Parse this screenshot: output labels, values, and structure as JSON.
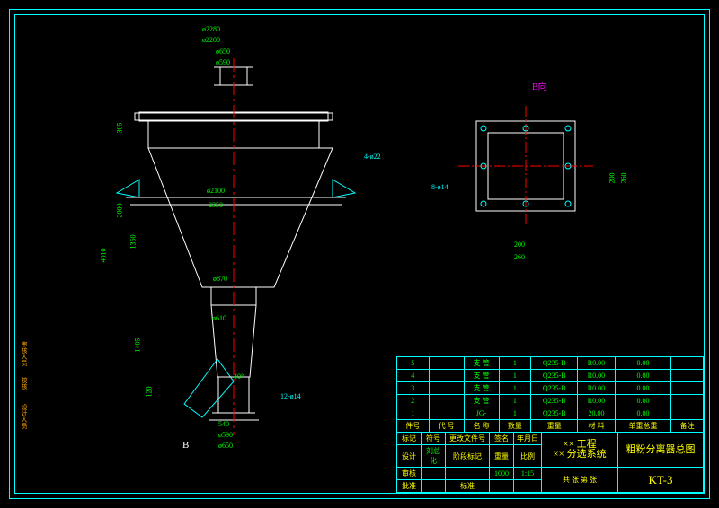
{
  "view_label": "B向",
  "main": {
    "dims": {
      "d2280": "ø2280",
      "d2200": "ø2200",
      "d650t": "ø650",
      "d590t": "ø590",
      "h305": "305",
      "h2000": "2000",
      "h4010": "4010",
      "h1350": "1350",
      "h1405": "1405",
      "h120": "120",
      "d870": "ø870",
      "d610": "ø610",
      "d540": "540",
      "d590b": "ø590",
      "d650b": "ø650",
      "d2100": "ø2100",
      "d2350": "2350",
      "ang": "40°",
      "note1": "4-ø22",
      "note2": "12-ø14",
      "arrow": "B"
    }
  },
  "aux": {
    "dims": {
      "w200i": "200",
      "w260o": "260",
      "h200i": "200",
      "h260o": "260",
      "note": "8-ø14"
    }
  },
  "bom": {
    "rows": [
      {
        "n": "5",
        "name": "支 管",
        "q": "1",
        "mat": "Q235-B",
        "wt": "R0.00",
        "tot": "0.00",
        "rm": ""
      },
      {
        "n": "4",
        "name": "支 管",
        "q": "1",
        "mat": "Q235-B",
        "wt": "R0.00",
        "tot": "0.00",
        "rm": ""
      },
      {
        "n": "3",
        "name": "支 管",
        "q": "1",
        "mat": "Q235-B",
        "wt": "R0.00",
        "tot": "0.00",
        "rm": ""
      },
      {
        "n": "2",
        "name": "支 管",
        "q": "1",
        "mat": "Q235-B",
        "wt": "R0.00",
        "tot": "0.00",
        "rm": ""
      },
      {
        "n": "1",
        "name": "JG-",
        "q": "1",
        "mat": "Q235-B",
        "wt": "20.00",
        "tot": "0.00",
        "rm": ""
      }
    ],
    "hdr": {
      "n": "件号",
      "code": "代 号",
      "name": "名 称",
      "q": "数量",
      "wt": "重量",
      "mat": "材 料",
      "sw": "单重总重",
      "rm": "备注"
    }
  },
  "title": {
    "proj1": "×× 工程",
    "proj2": "×× 分选系统",
    "drawname": "粗粉分离器总图",
    "drawno": "KT-3",
    "r1": {
      "a": "标记",
      "b": "符号",
      "c": "更改文件号",
      "d": "签名",
      "e": "年月日"
    },
    "r2": {
      "a": "设计",
      "b": "刘总化",
      "c": "阶段标记",
      "d": "重量",
      "e": "比例"
    },
    "r3": {
      "a": "审核",
      "c": "1:15",
      "d": "1000"
    },
    "r4": {
      "a": "批准",
      "b": "标准",
      "c": "共 张 第 张"
    }
  },
  "side": {
    "a": "审核人员",
    "b": "校核",
    "c": "设计人员"
  }
}
